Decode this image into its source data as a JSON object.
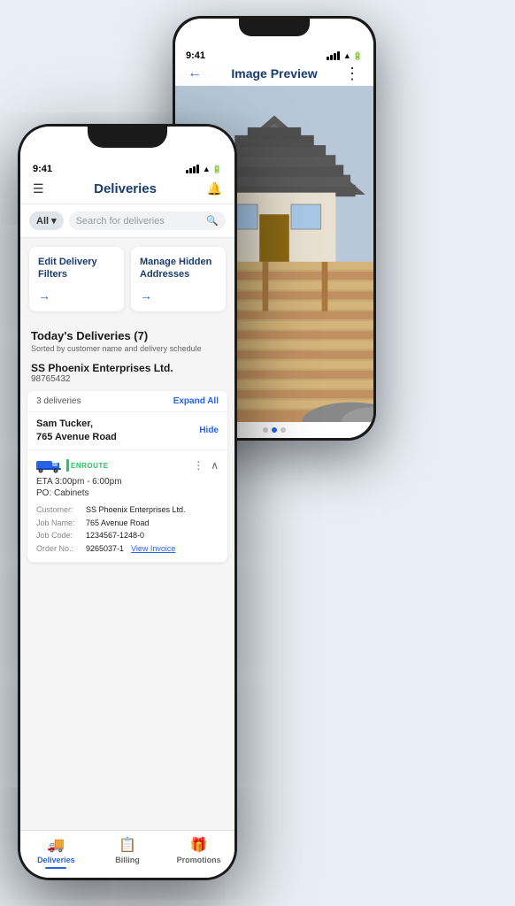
{
  "back_phone": {
    "status_time": "9:41",
    "header_title": "Image Preview",
    "more_icon": "⋮",
    "back_arrow": "←",
    "dots": [
      false,
      true,
      false
    ]
  },
  "front_phone": {
    "status_time": "9:41",
    "header": {
      "title": "Deliveries",
      "menu_icon": "☰",
      "bell_icon": "🔔"
    },
    "search": {
      "filter_label": "All",
      "placeholder": "Search for deliveries"
    },
    "action_cards": [
      {
        "title": "Edit Delivery Filters",
        "arrow": "→"
      },
      {
        "title": "Manage Hidden Addresses",
        "arrow": "→"
      }
    ],
    "section": {
      "title": "Today's Deliveries (7)",
      "subtitle": "Sorted by customer name and delivery schedule"
    },
    "company": {
      "name": "SS Phoenix Enterprises Ltd.",
      "id": "98765432"
    },
    "delivery_group": {
      "count": "3 deliveries",
      "expand_all": "Expand All",
      "address_line1": "Sam Tucker,",
      "address_line2": "765 Avenue Road",
      "hide": "Hide"
    },
    "delivery_item": {
      "status": "ENROUTE",
      "eta": "ETA 3:00pm - 6:00pm",
      "po": "PO: Cabinets",
      "customer_label": "Customer:",
      "customer_value": "SS Phoenix Enterprises Ltd.",
      "job_name_label": "Job Name:",
      "job_name_value": "765 Avenue Road",
      "job_code_label": "Job Code:",
      "job_code_value": "1234567-1248-0",
      "order_no_label": "Order No.:",
      "order_no_value": "9265037-1",
      "view_invoice": "View Invoice"
    },
    "bottom_nav": [
      {
        "icon": "🚚",
        "label": "Deliveries",
        "active": true
      },
      {
        "icon": "📋",
        "label": "Billing",
        "active": false
      },
      {
        "icon": "🎁",
        "label": "Promotions",
        "active": false
      }
    ]
  }
}
